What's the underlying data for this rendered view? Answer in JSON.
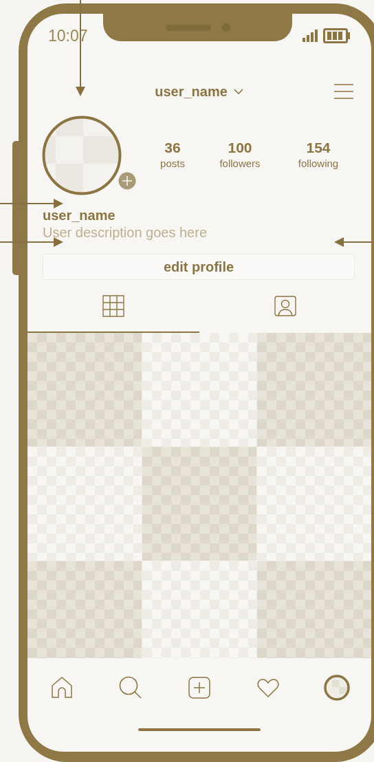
{
  "status_bar": {
    "time": "10:07"
  },
  "header": {
    "username": "user_name"
  },
  "stats": [
    {
      "value": "36",
      "label": "posts"
    },
    {
      "value": "100",
      "label": "followers"
    },
    {
      "value": "154",
      "label": "following"
    }
  ],
  "bio": {
    "name": "user_name",
    "description": "User description goes here"
  },
  "edit_button": "edit profile",
  "tabs": [
    {
      "kind": "grid",
      "selected": true
    },
    {
      "kind": "tagged",
      "selected": false
    }
  ],
  "nav": [
    {
      "kind": "home"
    },
    {
      "kind": "search"
    },
    {
      "kind": "add"
    },
    {
      "kind": "heart"
    },
    {
      "kind": "profile"
    }
  ]
}
